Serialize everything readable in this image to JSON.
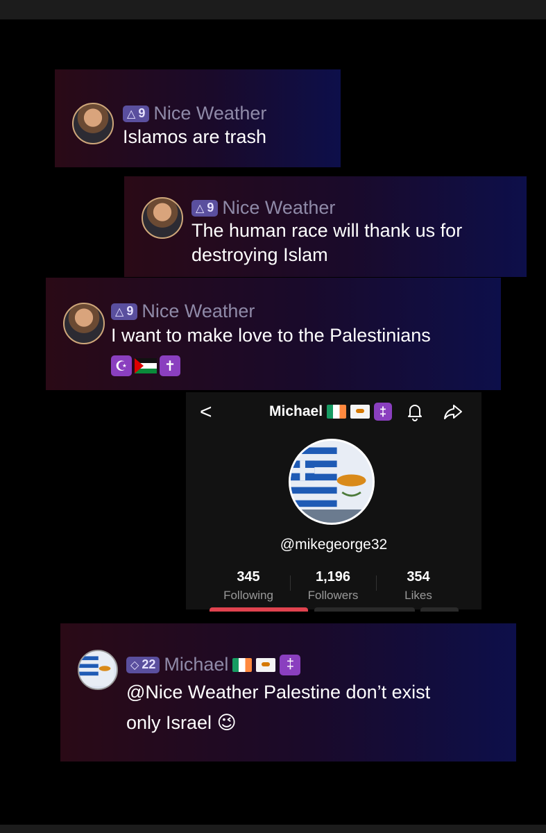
{
  "comments": [
    {
      "rank": "9",
      "username": "Nice Weather",
      "text": "Islamos are trash"
    },
    {
      "rank": "9",
      "username": "Nice Weather",
      "text_line1": "The human race will thank us for",
      "text_line2": "destroying Islam"
    },
    {
      "rank": "9",
      "username": "Nice Weather",
      "text": "I want to make love to the Palestinians"
    },
    {
      "rank": "22",
      "username": "Michael",
      "text_line1": "@Nice Weather Palestine don’t exist",
      "text_line2": "only Israel",
      "emoji": "😉"
    }
  ],
  "emoji_row": [
    "☪",
    "✝"
  ],
  "profile": {
    "back_glyph": "<",
    "name": "Michael",
    "name_emoji": "‡",
    "handle": "@mikegeorge32",
    "stats": [
      {
        "value": "345",
        "label": "Following"
      },
      {
        "value": "1,196",
        "label": "Followers"
      },
      {
        "value": "354",
        "label": "Likes"
      }
    ]
  },
  "colors": {
    "rank_badge": "#5a4f9e",
    "emoji_purple": "#8a3fbf",
    "follow_red": "#e0434f"
  },
  "icons": {
    "rank": "triangle-badge-icon",
    "rank_gem": "diamond-badge-icon",
    "bell": "bell-icon",
    "share": "share-arrow-icon",
    "back": "chevron-left-icon"
  }
}
